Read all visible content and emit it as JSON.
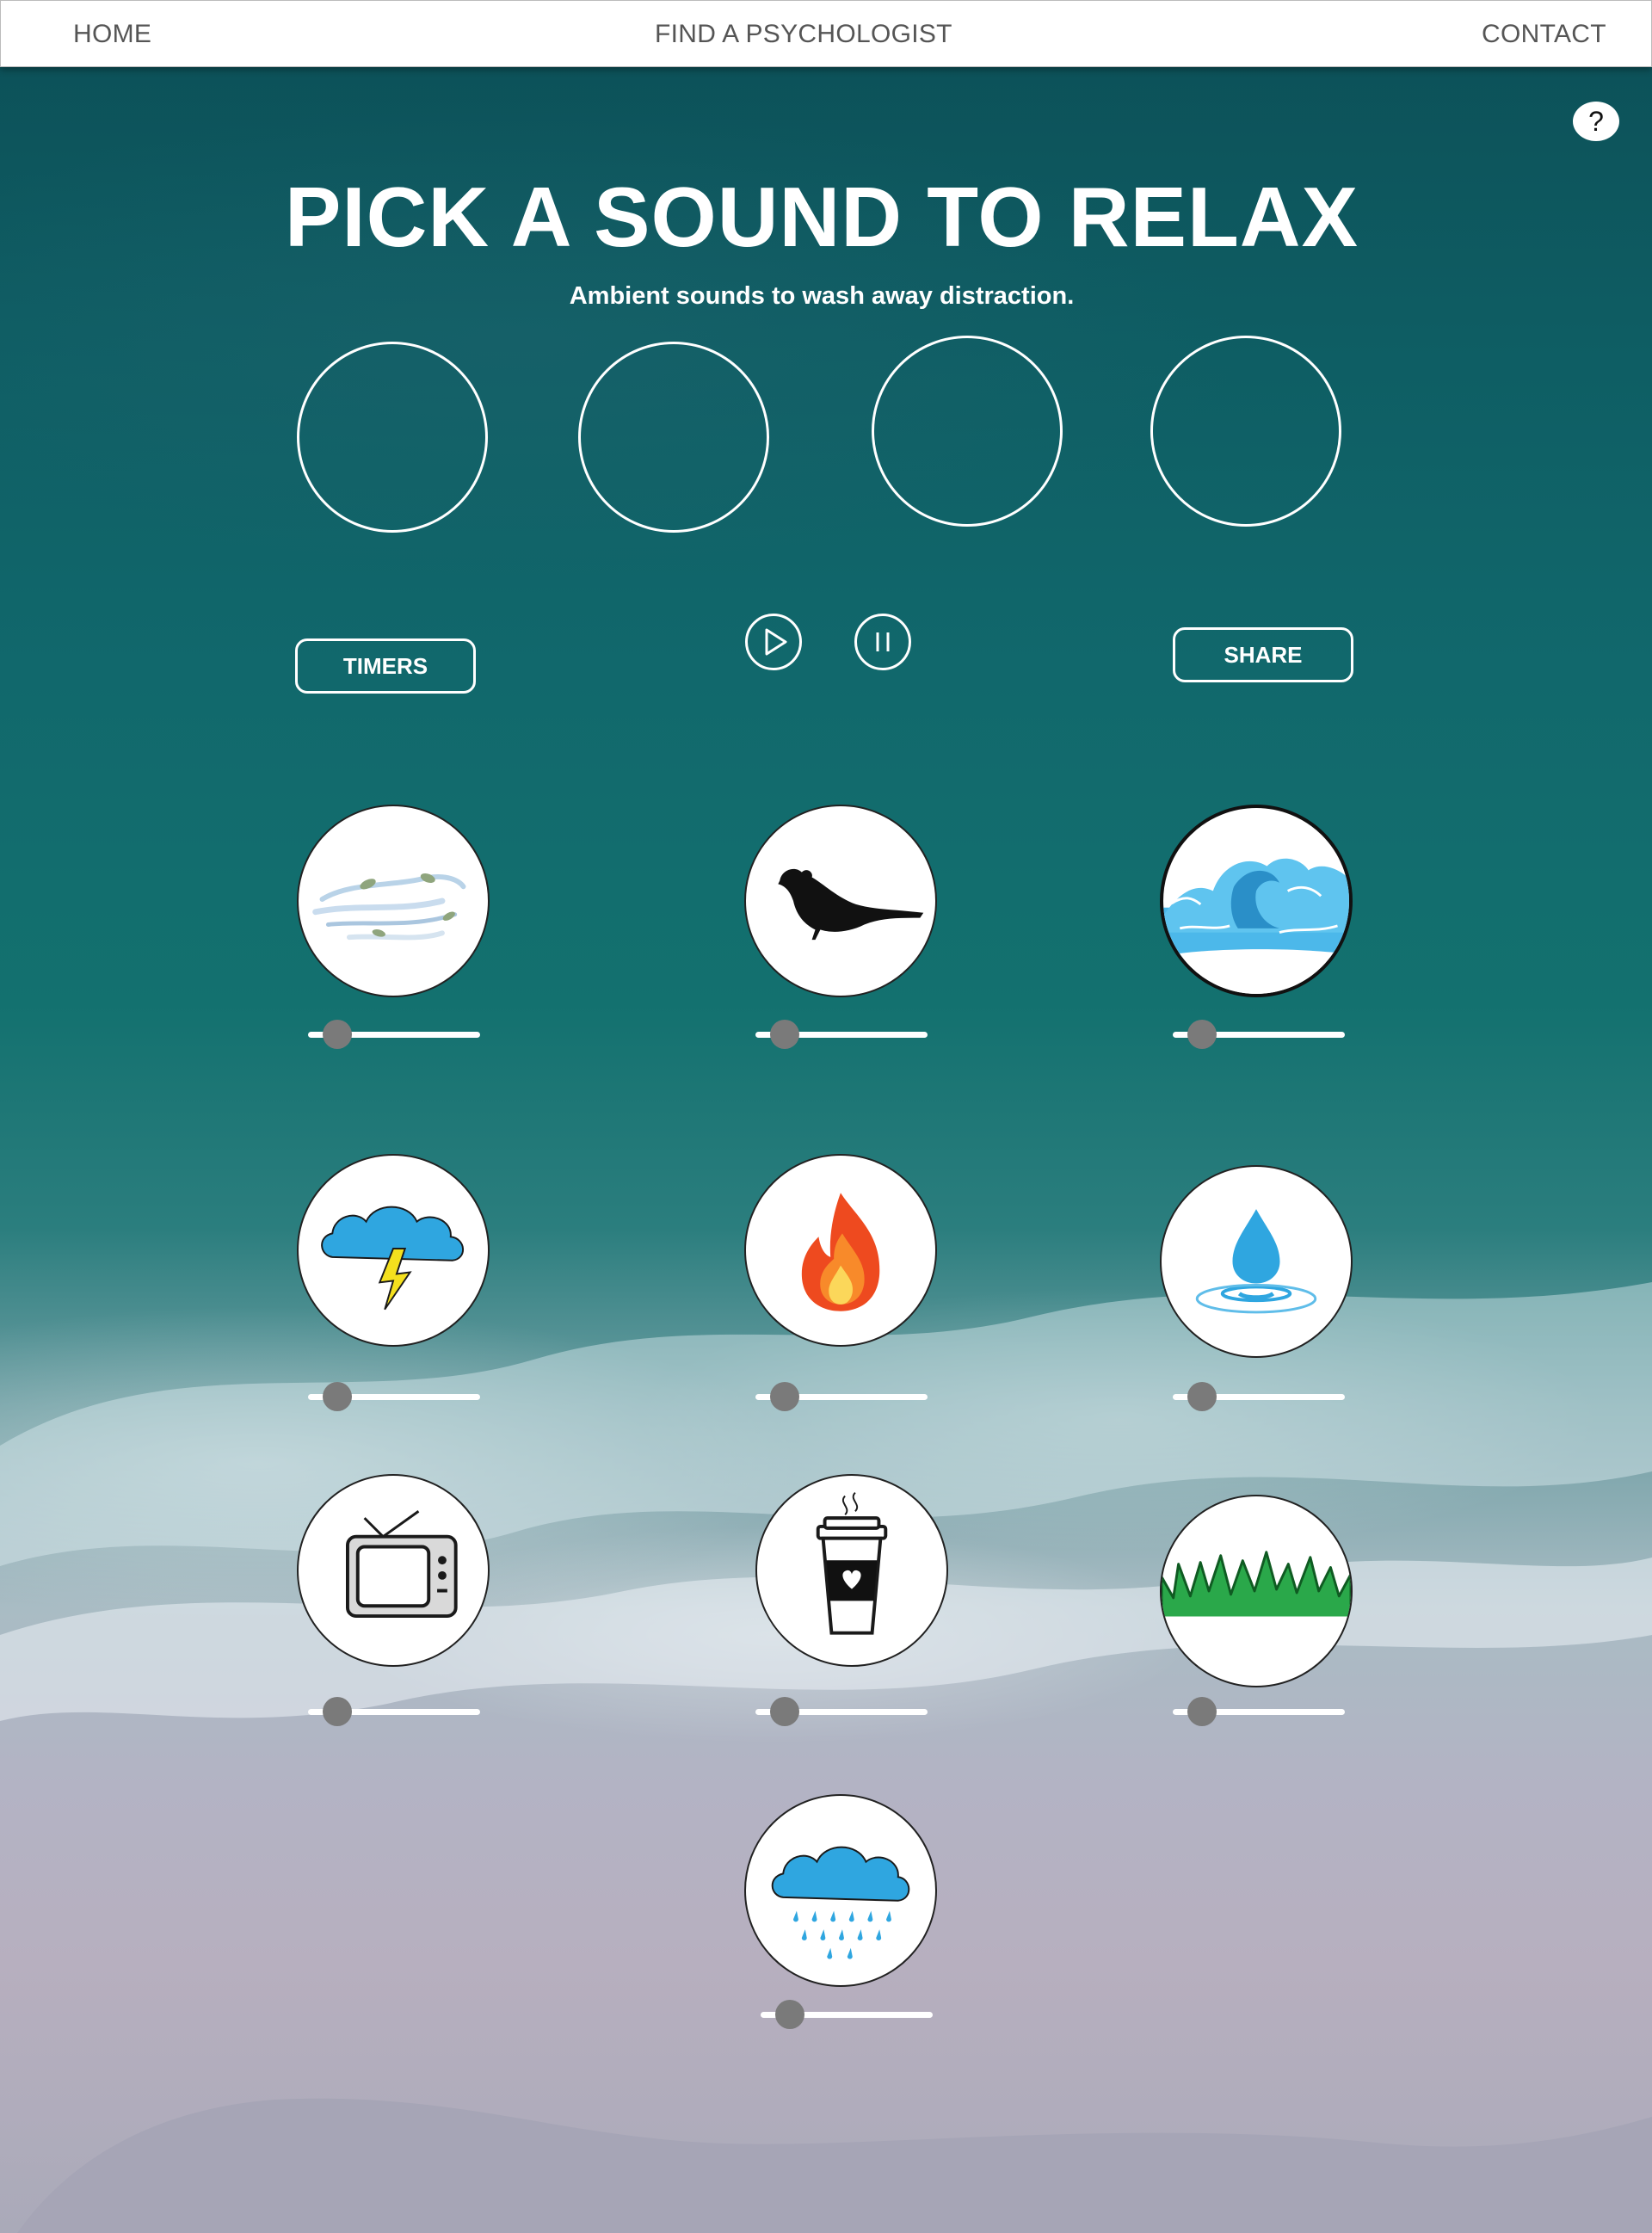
{
  "nav": {
    "home": "HOME",
    "find": "FIND A PSYCHOLOGIST",
    "contact": "CONTACT"
  },
  "header": {
    "help_label": "?",
    "title": "PICK A SOUND TO RELAX",
    "subtitle": "Ambient sounds to wash away distraction."
  },
  "controls": {
    "timers_label": "TIMERS",
    "share_label": "SHARE"
  },
  "sounds": [
    {
      "icon": "wind-icon",
      "volume": 0.1
    },
    {
      "icon": "bird-icon",
      "volume": 0.1
    },
    {
      "icon": "wave-icon",
      "volume": 0.1,
      "selected": true
    },
    {
      "icon": "thunderstorm-icon",
      "volume": 0.1
    },
    {
      "icon": "fire-icon",
      "volume": 0.1
    },
    {
      "icon": "water-drop-icon",
      "volume": 0.1
    },
    {
      "icon": "tv-icon",
      "volume": 0.1
    },
    {
      "icon": "coffee-cup-icon",
      "volume": 0.1
    },
    {
      "icon": "grass-icon",
      "volume": 0.1
    },
    {
      "icon": "rain-icon",
      "volume": 0.1
    }
  ],
  "colors": {
    "ocean": "#0e5d63",
    "sand": "#b3b3c4",
    "slider_thumb": "#7a7a7a"
  }
}
